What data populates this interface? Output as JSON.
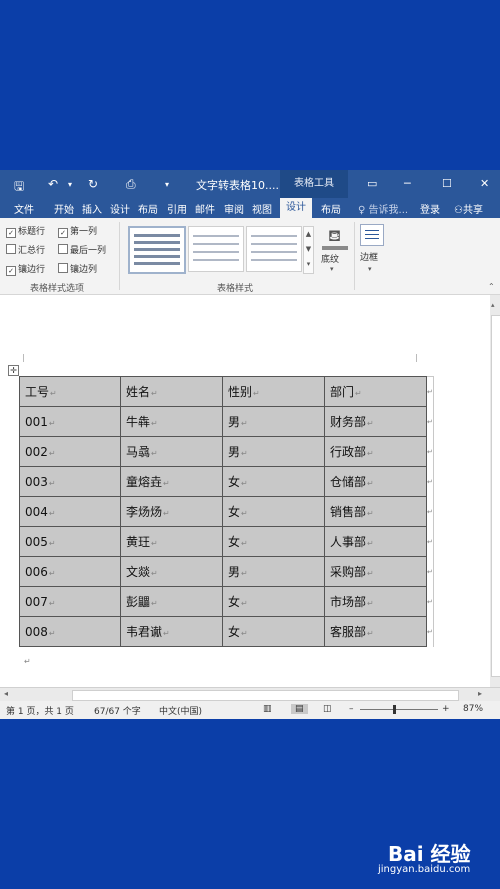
{
  "titlebar": {
    "doc_title": "文字转表格10....",
    "tool_tab": "表格工具",
    "window_controls": [
      "▭",
      "─",
      "☐",
      "✕"
    ]
  },
  "tabs": [
    {
      "label": "文件",
      "active": false
    },
    {
      "label": "开始",
      "active": false
    },
    {
      "label": "插入",
      "active": false
    },
    {
      "label": "设计",
      "active": false
    },
    {
      "label": "布局",
      "active": false
    },
    {
      "label": "引用",
      "active": false
    },
    {
      "label": "邮件",
      "active": false
    },
    {
      "label": "审阅",
      "active": false
    },
    {
      "label": "视图",
      "active": false
    },
    {
      "label": "设计",
      "active": true
    },
    {
      "label": "布局",
      "active": false
    }
  ],
  "tell_me": "告诉我...",
  "login": "登录",
  "share": "共享",
  "style_options": {
    "items": [
      {
        "label": "标题行",
        "checked": true
      },
      {
        "label": "第一列",
        "checked": true
      },
      {
        "label": "汇总行",
        "checked": false
      },
      {
        "label": "最后一列",
        "checked": false
      },
      {
        "label": "镶边行",
        "checked": true
      },
      {
        "label": "镶边列",
        "checked": false
      }
    ],
    "group_label": "表格样式选项"
  },
  "table_styles_label": "表格样式",
  "shading_label": "底纹",
  "borders_label": "边框",
  "table": {
    "rows": [
      [
        "工号",
        "姓名",
        "性别",
        "部门"
      ],
      [
        "001",
        "牛犇",
        "男",
        "财务部"
      ],
      [
        "002",
        "马骉",
        "男",
        "行政部"
      ],
      [
        "003",
        "童熔垚",
        "女",
        "仓储部"
      ],
      [
        "004",
        "李炀炀",
        "女",
        "销售部"
      ],
      [
        "005",
        "黄玨",
        "女",
        "人事部"
      ],
      [
        "006",
        "文燚",
        "男",
        "采购部"
      ],
      [
        "007",
        "彭鼺",
        "女",
        "市场部"
      ],
      [
        "008",
        "韦君谳",
        "女",
        "客服部"
      ]
    ]
  },
  "status": {
    "page": "第 1 页，共 1 页",
    "words": "67/67 个字",
    "language": "中文(中国)",
    "zoom": "87%"
  },
  "watermark": {
    "brand": "Bai 经验",
    "url": "jingyan.baidu.com"
  }
}
